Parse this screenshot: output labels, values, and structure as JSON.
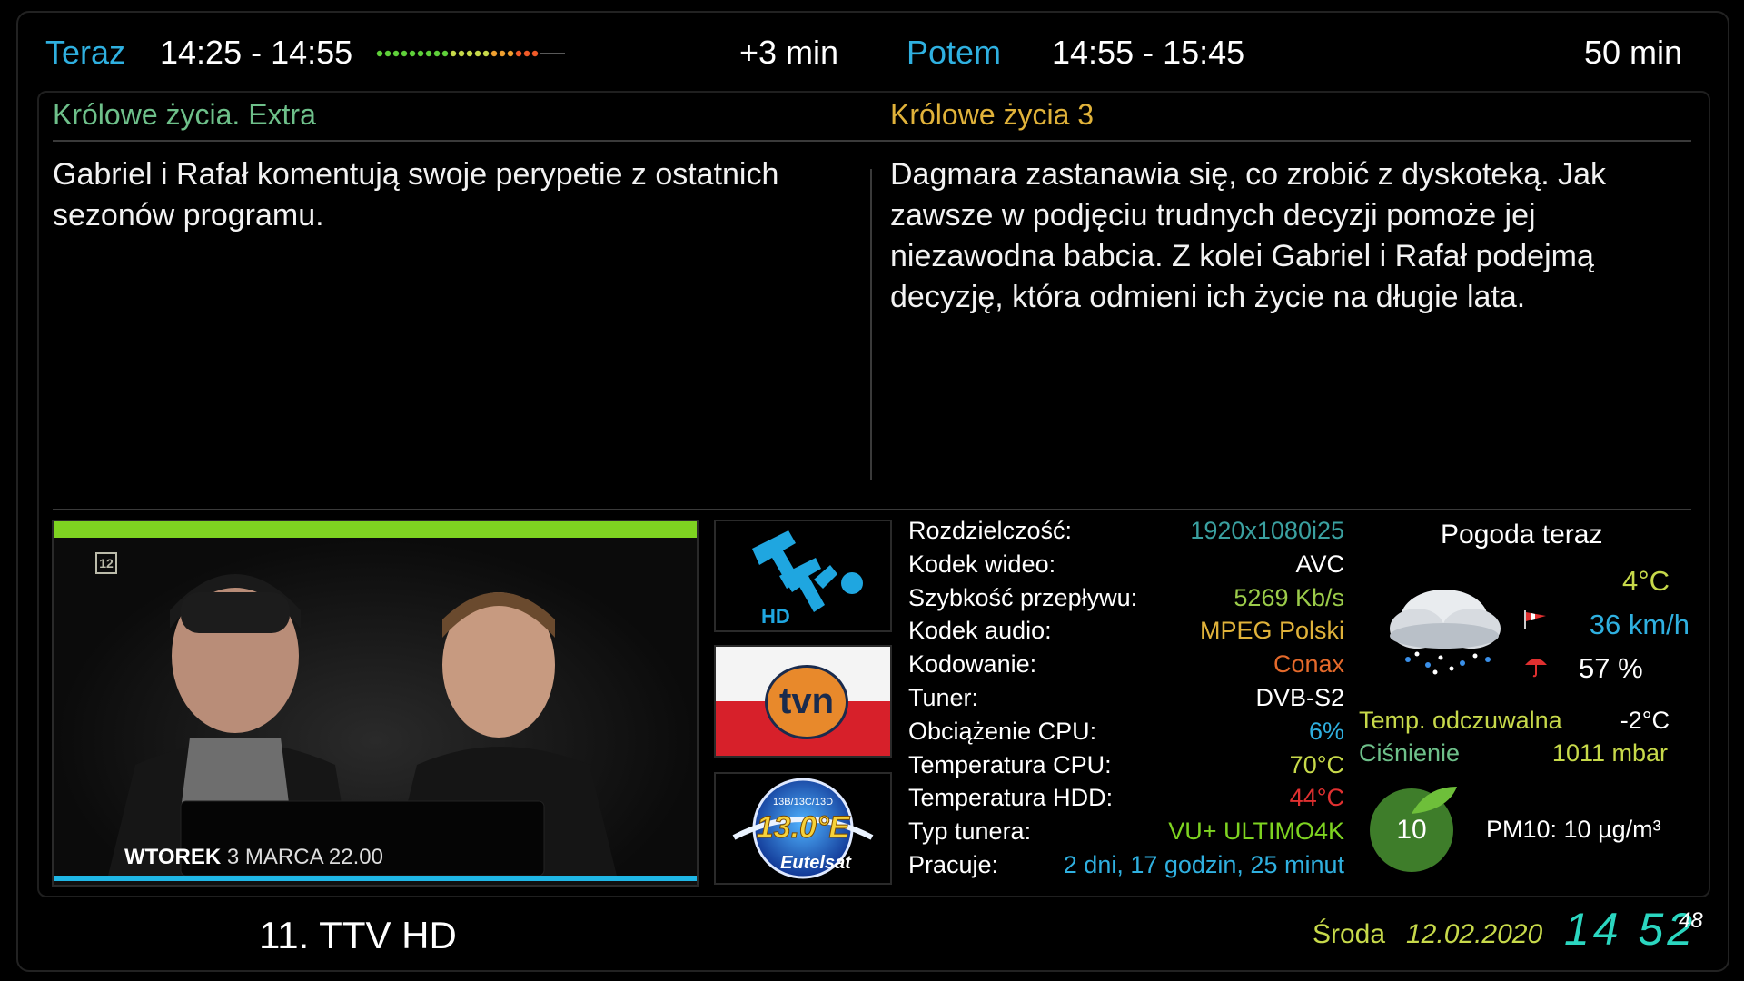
{
  "header": {
    "now_label": "Teraz",
    "now_time": "14:25 - 14:55",
    "progress_fraction": 0.85,
    "remaining": "+3 min",
    "next_label": "Potem",
    "next_time": "14:55 - 15:45",
    "next_duration": "50 min"
  },
  "now": {
    "title": "Królowe życia. Extra",
    "description": "Gabriel i Rafał komentują swoje perypetie z ostatnich sezonów programu."
  },
  "next": {
    "title": "Królowe życia 3",
    "description": "Dagmara zastanawia się, co zrobić z dyskoteką. Jak zawsze w podjęciu trudnych decyzji pomoże jej niezawodna babcia. Z kolei Gabriel i Rafał podejmą decyzję, która odmieni ich życie na długie lata."
  },
  "video": {
    "age_rating": "12",
    "promo_day": "WTOREK",
    "promo_rest": "3 MARCA 22.00"
  },
  "logos": {
    "channel_sub": "HD",
    "network": "tvn",
    "sat_position": "13.0°E",
    "sat_name": "Eutelsat",
    "sat_sub": "13B/13C/13D"
  },
  "tech": {
    "rows": [
      {
        "label": "Rozdzielczość:",
        "value": "1920x1080i25",
        "color": "#3aa0a0"
      },
      {
        "label": "Kodek wideo:",
        "value": "AVC",
        "color": "#ffffff"
      },
      {
        "label": "Szybkość przepływu:",
        "value": "5269 Kb/s",
        "color": "#9ccc4a"
      },
      {
        "label": "Kodek audio:",
        "value": "MPEG Polski",
        "color": "#e0b23a"
      },
      {
        "label": "Kodowanie:",
        "value": "Conax",
        "color": "#e56a2b"
      },
      {
        "label": "Tuner:",
        "value": "DVB-S2",
        "color": "#ffffff"
      },
      {
        "label": "Obciążenie CPU:",
        "value": "6%",
        "color": "#2fb0e0"
      },
      {
        "label": "Temperatura CPU:",
        "value": "70°C",
        "color": "#c7d94a"
      },
      {
        "label": "Temperatura HDD:",
        "value": "44°C",
        "color": "#e03030"
      },
      {
        "label": "Typ tunera:",
        "value": "VU+ ULTIMO4K",
        "color": "#7ed321"
      },
      {
        "label": "Pracuje:",
        "value": "2 dni, 17 godzin, 25 minut",
        "color": "#2fb0e0"
      }
    ]
  },
  "weather": {
    "title": "Pogoda teraz",
    "temp": "4°C",
    "wind": "36 km/h",
    "humidity": "57 %",
    "feels_label": "Temp. odczuwalna",
    "feels_value": "-2°C",
    "pressure_label": "Ciśnienie",
    "pressure_value": "1011 mbar",
    "pm_index": "10",
    "pm_text": "PM10: 10 µg/m³",
    "colors": {
      "temp": "#c7d94a",
      "wind": "#2fb0e0",
      "feels_label": "#c7d94a",
      "pressure_label": "#6ec08a",
      "pressure_value": "#c7d94a"
    }
  },
  "footer": {
    "channel": "11. TTV HD",
    "day": "Środa",
    "date": "12.02.2020",
    "clock": "14 52",
    "seconds": "48"
  }
}
